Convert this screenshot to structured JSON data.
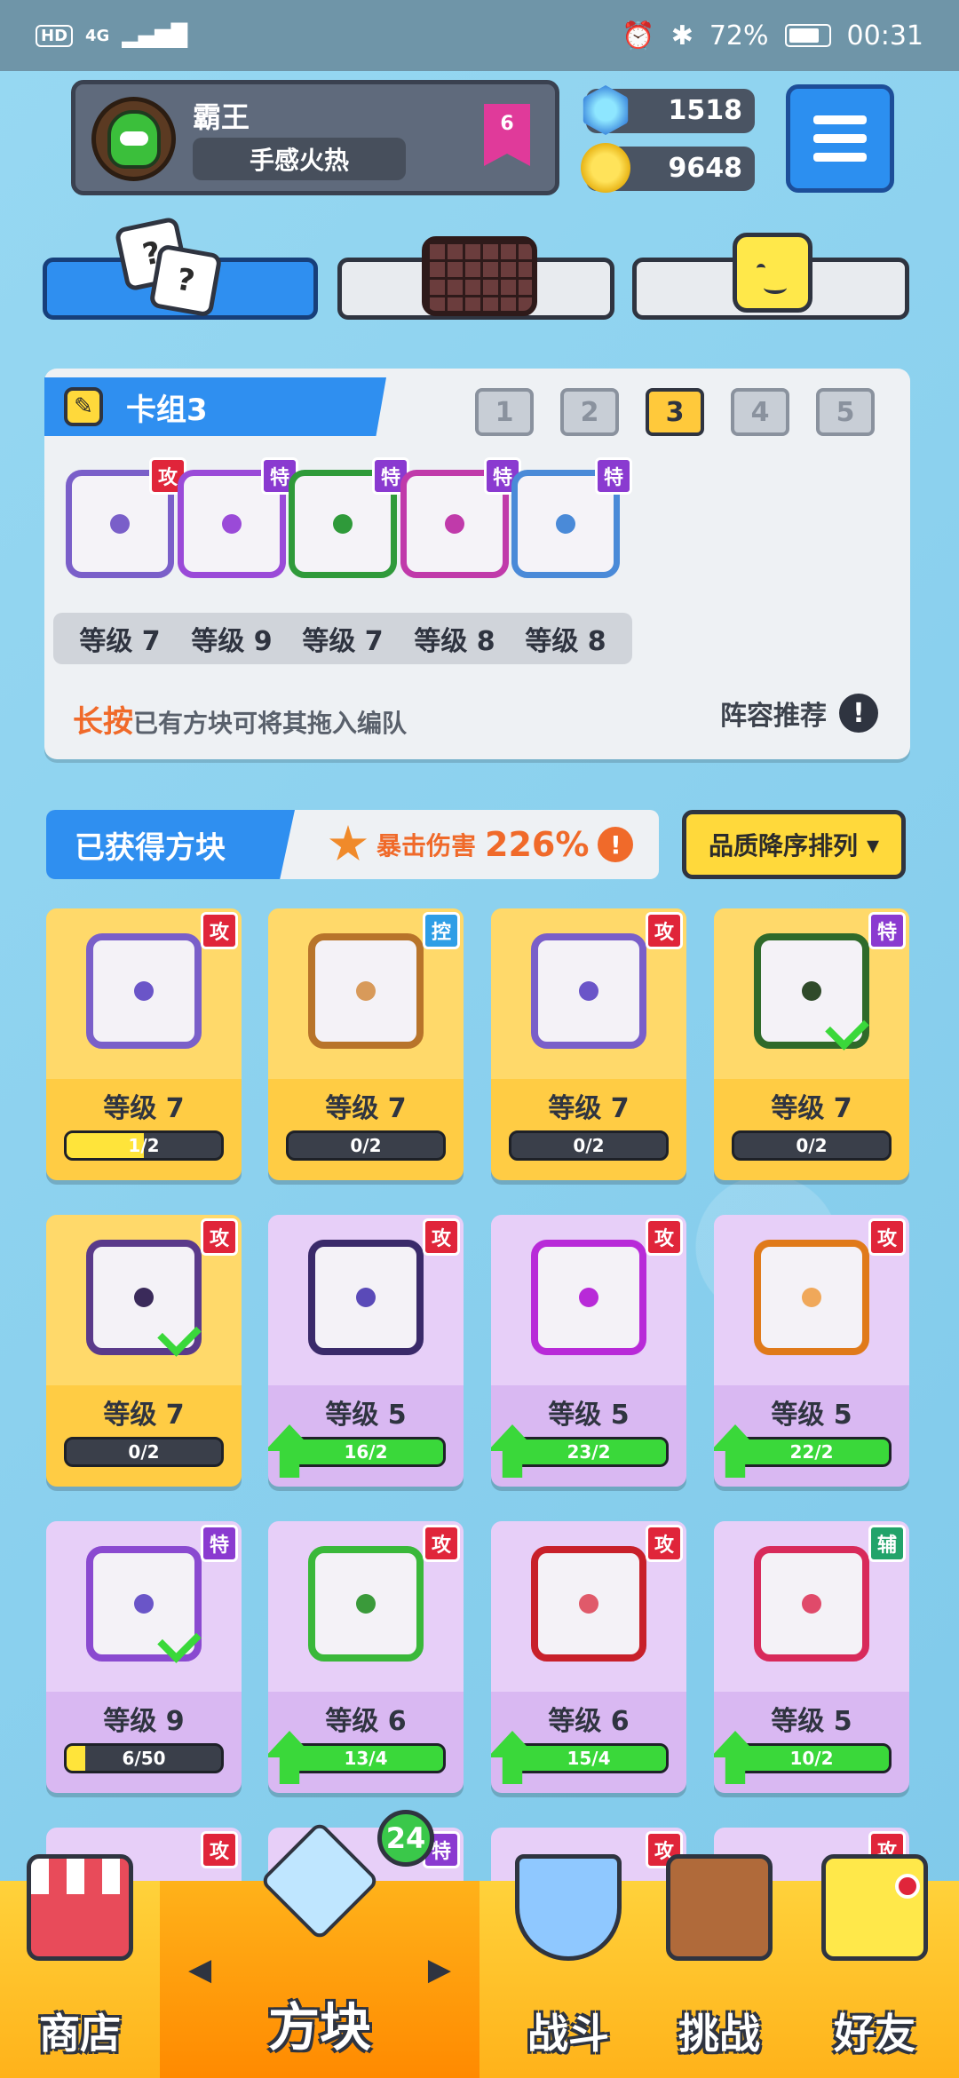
{
  "status_bar": {
    "hd": "HD",
    "network": "4G",
    "battery": "72%",
    "time": "00:31"
  },
  "profile": {
    "name": "霸王",
    "title": "手感火热",
    "rank": "6"
  },
  "currency": {
    "gems": "1518",
    "coins": "9648"
  },
  "deck": {
    "name": "卡组3",
    "slots": [
      "1",
      "2",
      "3",
      "4",
      "5"
    ],
    "selected_slot": "3",
    "cards": [
      {
        "type": "攻",
        "level": "等级 7",
        "color": "#7a5fc9"
      },
      {
        "type": "特",
        "level": "等级 9",
        "color": "#9a4ad8"
      },
      {
        "type": "特",
        "level": "等级 7",
        "color": "#2f9a3a"
      },
      {
        "type": "特",
        "level": "等级 8",
        "color": "#c03aaa"
      },
      {
        "type": "特",
        "level": "等级 8",
        "color": "#4a8ad8"
      }
    ],
    "hint_bold": "长按",
    "hint_rest": "已有方块可将其拖入编队",
    "recommend": "阵容推荐",
    "recommend_icon": "!"
  },
  "owned": {
    "title": "已获得方块",
    "crit_label": "暴击伤害",
    "crit_value": "226%",
    "crit_icon": "!",
    "sort_label": "品质降序排列",
    "sort_icon": "▾"
  },
  "cards": [
    {
      "type": "攻",
      "level": "等级 7",
      "progress": "1/2",
      "fill": 0.5,
      "rarity": "legend",
      "color": "#7a5fc9",
      "dot": "#6a55c8",
      "upgrade": false,
      "check": false
    },
    {
      "type": "控",
      "level": "等级 7",
      "progress": "0/2",
      "fill": 0,
      "rarity": "legend",
      "color": "#b8742a",
      "dot": "#d89a5a",
      "upgrade": false,
      "check": false
    },
    {
      "type": "攻",
      "level": "等级 7",
      "progress": "0/2",
      "fill": 0,
      "rarity": "legend",
      "color": "#7a5fc9",
      "dot": "#6a55c8",
      "upgrade": false,
      "check": false
    },
    {
      "type": "特",
      "level": "等级 7",
      "progress": "0/2",
      "fill": 0,
      "rarity": "legend",
      "color": "#2f6a2a",
      "dot": "#2f4a2a",
      "upgrade": false,
      "check": true
    },
    {
      "type": "攻",
      "level": "等级 7",
      "progress": "0/2",
      "fill": 0,
      "rarity": "legend",
      "color": "#5a3a8a",
      "dot": "#3a2a5a",
      "upgrade": false,
      "check": true
    },
    {
      "type": "攻",
      "level": "等级 5",
      "progress": "16/2",
      "fill": 1,
      "rarity": "epic",
      "color": "#3a2a6a",
      "dot": "#5a4ab8",
      "upgrade": true,
      "check": false
    },
    {
      "type": "攻",
      "level": "等级 5",
      "progress": "23/2",
      "fill": 1,
      "rarity": "epic",
      "color": "#b82ad8",
      "dot": "#b82ad8",
      "upgrade": true,
      "check": false
    },
    {
      "type": "攻",
      "level": "等级 5",
      "progress": "22/2",
      "fill": 1,
      "rarity": "epic",
      "color": "#e07a1a",
      "dot": "#f0a85a",
      "upgrade": true,
      "check": false
    },
    {
      "type": "特",
      "level": "等级 9",
      "progress": "6/50",
      "fill": 0.12,
      "rarity": "epic",
      "color": "#8a4ad0",
      "dot": "#6a55c8",
      "upgrade": false,
      "check": true
    },
    {
      "type": "攻",
      "level": "等级 6",
      "progress": "13/4",
      "fill": 1,
      "rarity": "epic",
      "color": "#3ab83a",
      "dot": "#3a9a3a",
      "upgrade": true,
      "check": false
    },
    {
      "type": "攻",
      "level": "等级 6",
      "progress": "15/4",
      "fill": 1,
      "rarity": "epic",
      "color": "#c8202a",
      "dot": "#e05a6a",
      "upgrade": true,
      "check": false
    },
    {
      "type": "辅",
      "level": "等级 5",
      "progress": "10/2",
      "fill": 1,
      "rarity": "epic",
      "color": "#d82a5a",
      "dot": "#e04a6a",
      "upgrade": true,
      "check": false
    }
  ],
  "partial_row": [
    {
      "type": "攻"
    },
    {
      "type": "特"
    },
    {
      "type": "攻"
    },
    {
      "type": "攻"
    }
  ],
  "nav": {
    "items": [
      {
        "label": "商店",
        "icon": "shop-icon"
      },
      {
        "label": "方块",
        "icon": "dice-cube-icon"
      },
      {
        "label": "战斗",
        "icon": "battle-shield-icon"
      },
      {
        "label": "挑战",
        "icon": "challenge-gate-icon"
      },
      {
        "label": "好友",
        "icon": "friend-icon"
      }
    ],
    "active": "方块",
    "cube_badge": "24",
    "arrow_left": "◀",
    "arrow_right": "▶"
  }
}
